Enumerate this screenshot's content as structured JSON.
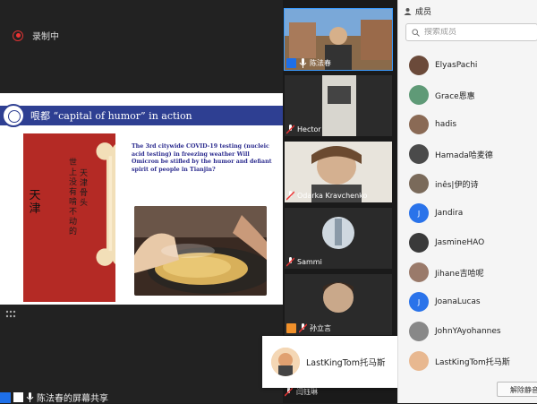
{
  "recording": {
    "label": "录制中"
  },
  "slide": {
    "title": "哏都 “capital of humor” in action",
    "body": "The 3rd citywide COVID-19 testing (nucleic acid testing) in freezing weather Will Omicron be stifled by the humor and defiant spirit of people in Tianjin?",
    "poster_line1": "世上没有啃不动的",
    "poster_line2": "天津骨头",
    "poster_big": "天津"
  },
  "share_bar": {
    "label": "陈法春的屏幕共享"
  },
  "videos": [
    {
      "name": "陈法春",
      "badge": "blue",
      "active": true,
      "mic": "on"
    },
    {
      "name": "Hector",
      "badge": "none",
      "active": false,
      "mic": "muted"
    },
    {
      "name": "Odarka Kravchenko",
      "badge": "none",
      "active": false,
      "mic": "muted"
    },
    {
      "name": "Sammi",
      "badge": "none",
      "active": false,
      "mic": "muted"
    },
    {
      "name": "孙立言",
      "badge": "orange",
      "active": false,
      "mic": "muted"
    }
  ],
  "bottom_video_name": "闫钰琳",
  "popup": {
    "name": "LastKingTom托马斯"
  },
  "panel": {
    "title": "成员",
    "search_placeholder": "搜索成员",
    "members": [
      {
        "name": "ElyasPachi",
        "avatar": "photo",
        "color": "#6b4a3a"
      },
      {
        "name": "Grace恩惠",
        "avatar": "photo",
        "color": "#5f9a77"
      },
      {
        "name": "hadis",
        "avatar": "photo",
        "color": "#8a6a55"
      },
      {
        "name": "Hamada哈麦德",
        "avatar": "photo",
        "color": "#4a4a4a"
      },
      {
        "name": "inês|伊的诗",
        "avatar": "photo",
        "color": "#7a6a5a"
      },
      {
        "name": "Jandira",
        "avatar": "letter",
        "letter": "J",
        "color": "#2a73ea"
      },
      {
        "name": "JasmineHAO",
        "avatar": "photo",
        "color": "#3a3a3a"
      },
      {
        "name": "Jihane吉哈呢",
        "avatar": "photo",
        "color": "#9a7a6a"
      },
      {
        "name": "JoanaLucas",
        "avatar": "letter",
        "letter": "J",
        "color": "#2a73ea"
      },
      {
        "name": "JohnYAyohannes",
        "avatar": "photo",
        "color": "#888888"
      },
      {
        "name": "LastKingTom托马斯",
        "avatar": "photo",
        "color": "#e8b890"
      }
    ],
    "mute_all": "解除静音"
  }
}
